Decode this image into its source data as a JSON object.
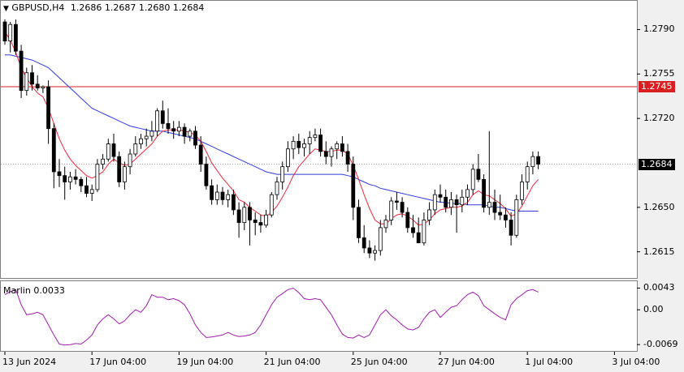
{
  "header": {
    "symbol_tf": "GBPUSD,H4",
    "ohlc": "1.2686 1.2687 1.2680 1.2684"
  },
  "indicator": {
    "title": "Marlin 0.0033"
  },
  "colors": {
    "bull": "#ffffff",
    "bear": "#000000",
    "outline": "#000000",
    "ma_fast": "#e8283c",
    "ma_slow": "#2f3cd8",
    "hline": "#d82020",
    "osc": "#9c1ea8",
    "grid": "#c8c8c8",
    "current": "#000000"
  },
  "chart_data": [
    {
      "type": "candlestick",
      "symbol": "GBPUSD",
      "timeframe": "H4",
      "y_ticks": [
        "1.2790",
        "1.2755",
        "1.2720",
        "1.2650",
        "1.2615"
      ],
      "ylim": [
        1.2595,
        1.2812
      ],
      "horizontal_line": {
        "value": "1.2745"
      },
      "current_price": "1.2684",
      "x_labels": [
        "13 Jun 2024",
        "17 Jun 04:00",
        "19 Jun 04:00",
        "21 Jun 04:00",
        "25 Jun 04:00",
        "27 Jun 04:00",
        "1 Jul 04:00",
        "3 Jul 04:00"
      ],
      "x_label_bar_index": [
        0,
        16,
        32,
        48,
        64,
        80,
        96,
        112
      ],
      "candles": [
        [
          1.2796,
          1.2798,
          1.2778,
          1.2781
        ],
        [
          1.2781,
          1.2796,
          1.2772,
          1.2794
        ],
        [
          1.2794,
          1.2798,
          1.277,
          1.2773
        ],
        [
          1.2773,
          1.2778,
          1.2736,
          1.2742
        ],
        [
          1.2742,
          1.276,
          1.2738,
          1.2756
        ],
        [
          1.2756,
          1.2762,
          1.2742,
          1.2747
        ],
        [
          1.2747,
          1.2754,
          1.2742,
          1.2744
        ],
        [
          1.2744,
          1.2746,
          1.274,
          1.2745
        ],
        [
          1.2745,
          1.275,
          1.27,
          1.2712
        ],
        [
          1.2712,
          1.2716,
          1.2665,
          1.2678
        ],
        [
          1.2678,
          1.2688,
          1.2666,
          1.2675
        ],
        [
          1.2675,
          1.2682,
          1.2656,
          1.267
        ],
        [
          1.267,
          1.2678,
          1.2664,
          1.2674
        ],
        [
          1.2674,
          1.268,
          1.2668,
          1.2672
        ],
        [
          1.2672,
          1.2674,
          1.2662,
          1.2667
        ],
        [
          1.2667,
          1.2674,
          1.2658,
          1.2661
        ],
        [
          1.2661,
          1.2668,
          1.2655,
          1.2664
        ],
        [
          1.2664,
          1.2688,
          1.2662,
          1.2684
        ],
        [
          1.2684,
          1.2692,
          1.268,
          1.2688
        ],
        [
          1.2688,
          1.2704,
          1.2686,
          1.27
        ],
        [
          1.27,
          1.2708,
          1.2686,
          1.269
        ],
        [
          1.269,
          1.2694,
          1.2666,
          1.267
        ],
        [
          1.267,
          1.2686,
          1.2664,
          1.2682
        ],
        [
          1.2682,
          1.2696,
          1.2676,
          1.2692
        ],
        [
          1.2692,
          1.2706,
          1.269,
          1.27
        ],
        [
          1.27,
          1.2708,
          1.2696,
          1.2704
        ],
        [
          1.2704,
          1.2712,
          1.2698,
          1.2706
        ],
        [
          1.2706,
          1.2718,
          1.2702,
          1.271
        ],
        [
          1.271,
          1.2728,
          1.2706,
          1.2726
        ],
        [
          1.2726,
          1.2734,
          1.2712,
          1.2716
        ],
        [
          1.2716,
          1.2728,
          1.2708,
          1.2712
        ],
        [
          1.2712,
          1.2718,
          1.2704,
          1.271
        ],
        [
          1.271,
          1.2718,
          1.2706,
          1.2713
        ],
        [
          1.2713,
          1.2716,
          1.27,
          1.2706
        ],
        [
          1.2706,
          1.2712,
          1.2702,
          1.271
        ],
        [
          1.271,
          1.2714,
          1.2696,
          1.2699
        ],
        [
          1.2699,
          1.2706,
          1.2678,
          1.2684
        ],
        [
          1.2684,
          1.269,
          1.2664,
          1.2667
        ],
        [
          1.2667,
          1.2672,
          1.2652,
          1.2656
        ],
        [
          1.2656,
          1.2668,
          1.2652,
          1.2662
        ],
        [
          1.2662,
          1.2666,
          1.2652,
          1.2656
        ],
        [
          1.2656,
          1.2664,
          1.265,
          1.266
        ],
        [
          1.266,
          1.2664,
          1.2644,
          1.2648
        ],
        [
          1.2648,
          1.2654,
          1.2626,
          1.2638
        ],
        [
          1.2638,
          1.2654,
          1.2632,
          1.265
        ],
        [
          1.265,
          1.2654,
          1.262,
          1.264
        ],
        [
          1.264,
          1.2646,
          1.2628,
          1.2638
        ],
        [
          1.2638,
          1.2644,
          1.263,
          1.2636
        ],
        [
          1.2636,
          1.2648,
          1.2634,
          1.2644
        ],
        [
          1.2644,
          1.2662,
          1.2642,
          1.266
        ],
        [
          1.266,
          1.2674,
          1.2656,
          1.267
        ],
        [
          1.267,
          1.2686,
          1.2664,
          1.2682
        ],
        [
          1.2682,
          1.2702,
          1.2678,
          1.2696
        ],
        [
          1.2696,
          1.2706,
          1.2688,
          1.2702
        ],
        [
          1.2702,
          1.2708,
          1.2692,
          1.2697
        ],
        [
          1.2697,
          1.2704,
          1.269,
          1.27
        ],
        [
          1.27,
          1.271,
          1.2692,
          1.2705
        ],
        [
          1.2705,
          1.2712,
          1.2702,
          1.2707
        ],
        [
          1.2707,
          1.2712,
          1.269,
          1.2694
        ],
        [
          1.2694,
          1.2702,
          1.2684,
          1.269
        ],
        [
          1.269,
          1.2698,
          1.2682,
          1.2696
        ],
        [
          1.2696,
          1.2702,
          1.2688,
          1.27
        ],
        [
          1.27,
          1.2706,
          1.269,
          1.2694
        ],
        [
          1.2694,
          1.27,
          1.2678,
          1.2684
        ],
        [
          1.2684,
          1.269,
          1.264,
          1.265
        ],
        [
          1.265,
          1.2656,
          1.2622,
          1.2626
        ],
        [
          1.2626,
          1.2636,
          1.2614,
          1.2618
        ],
        [
          1.2618,
          1.2624,
          1.261,
          1.2614
        ],
        [
          1.2614,
          1.262,
          1.2608,
          1.2616
        ],
        [
          1.2616,
          1.264,
          1.2612,
          1.2634
        ],
        [
          1.2634,
          1.2644,
          1.263,
          1.264
        ],
        [
          1.264,
          1.2658,
          1.2636,
          1.2655
        ],
        [
          1.2655,
          1.2662,
          1.2648,
          1.2654
        ],
        [
          1.2654,
          1.2658,
          1.2642,
          1.2646
        ],
        [
          1.2646,
          1.265,
          1.263,
          1.2634
        ],
        [
          1.2634,
          1.2644,
          1.2626,
          1.263
        ],
        [
          1.263,
          1.2642,
          1.2624,
          1.2622
        ],
        [
          1.2622,
          1.2646,
          1.262,
          1.264
        ],
        [
          1.264,
          1.2654,
          1.2636,
          1.2648
        ],
        [
          1.2648,
          1.2664,
          1.2644,
          1.266
        ],
        [
          1.266,
          1.2668,
          1.2654,
          1.2658
        ],
        [
          1.2658,
          1.2664,
          1.2646,
          1.265
        ],
        [
          1.265,
          1.2662,
          1.2644,
          1.2656
        ],
        [
          1.2656,
          1.266,
          1.263,
          1.2652
        ],
        [
          1.2652,
          1.2664,
          1.2646,
          1.2658
        ],
        [
          1.2658,
          1.2668,
          1.2652,
          1.2664
        ],
        [
          1.2664,
          1.2684,
          1.266,
          1.268
        ],
        [
          1.268,
          1.2692,
          1.267,
          1.2672
        ],
        [
          1.2672,
          1.2676,
          1.2646,
          1.265
        ],
        [
          1.265,
          1.271,
          1.2644,
          1.2654
        ],
        [
          1.2654,
          1.2664,
          1.264,
          1.2646
        ],
        [
          1.2646,
          1.266,
          1.264,
          1.2644
        ],
        [
          1.2644,
          1.265,
          1.2634,
          1.264
        ],
        [
          1.264,
          1.2646,
          1.262,
          1.2628
        ],
        [
          1.2628,
          1.266,
          1.2626,
          1.2656
        ],
        [
          1.2656,
          1.2676,
          1.2652,
          1.267
        ],
        [
          1.267,
          1.2686,
          1.2664,
          1.2682
        ],
        [
          1.2682,
          1.2694,
          1.2676,
          1.269
        ],
        [
          1.269,
          1.2694,
          1.268,
          1.2684
        ]
      ],
      "ma_fast": [
        1.2788,
        1.2782,
        1.2772,
        1.276,
        1.2752,
        1.2745,
        1.274,
        1.2737,
        1.2728,
        1.2716,
        1.2704,
        1.2695,
        1.2688,
        1.2683,
        1.2679,
        1.2675,
        1.2673,
        1.2675,
        1.2678,
        1.2684,
        1.2688,
        1.2685,
        1.2683,
        1.2684,
        1.2688,
        1.2692,
        1.2696,
        1.27,
        1.2706,
        1.271,
        1.2711,
        1.2711,
        1.2711,
        1.271,
        1.2709,
        1.2707,
        1.2702,
        1.2694,
        1.2685,
        1.2679,
        1.2673,
        1.2668,
        1.2663,
        1.2656,
        1.2654,
        1.265,
        1.2647,
        1.2644,
        1.2643,
        1.2646,
        1.2651,
        1.2658,
        1.2666,
        1.2675,
        1.2682,
        1.2687,
        1.2692,
        1.2696,
        1.2695,
        1.2694,
        1.2694,
        1.2695,
        1.2695,
        1.2692,
        1.2683,
        1.2672,
        1.266,
        1.2649,
        1.264,
        1.2637,
        1.2637,
        1.2641,
        1.2644,
        1.2645,
        1.2643,
        1.264,
        1.2636,
        1.2637,
        1.264,
        1.2645,
        1.2648,
        1.2649,
        1.265,
        1.265,
        1.2651,
        1.2654,
        1.266,
        1.2663,
        1.266,
        1.2659,
        1.2656,
        1.2653,
        1.2649,
        1.2643,
        1.2645,
        1.2651,
        1.2659,
        1.2667,
        1.2672
      ],
      "ma_slow": [
        1.277,
        1.277,
        1.2769,
        1.2768,
        1.2767,
        1.2766,
        1.2764,
        1.2762,
        1.276,
        1.2756,
        1.2752,
        1.2748,
        1.2744,
        1.274,
        1.2736,
        1.2732,
        1.2728,
        1.2726,
        1.2724,
        1.2722,
        1.272,
        1.2718,
        1.2716,
        1.2714,
        1.2713,
        1.2712,
        1.2711,
        1.271,
        1.271,
        1.271,
        1.2709,
        1.2708,
        1.2707,
        1.2706,
        1.2705,
        1.2704,
        1.2702,
        1.27,
        1.2698,
        1.2696,
        1.2694,
        1.2692,
        1.269,
        1.2688,
        1.2686,
        1.2684,
        1.2682,
        1.268,
        1.2678,
        1.2677,
        1.2676,
        1.2676,
        1.2676,
        1.2676,
        1.2676,
        1.2676,
        1.2676,
        1.2676,
        1.2676,
        1.2676,
        1.2676,
        1.2676,
        1.2676,
        1.2675,
        1.2674,
        1.2672,
        1.267,
        1.2668,
        1.2667,
        1.2665,
        1.2664,
        1.2663,
        1.2662,
        1.2661,
        1.266,
        1.2659,
        1.2658,
        1.2657,
        1.2656,
        1.2655,
        1.2654,
        1.2654,
        1.2653,
        1.2653,
        1.2653,
        1.2652,
        1.2652,
        1.2652,
        1.2652,
        1.2651,
        1.265,
        1.265,
        1.2649,
        1.2648,
        1.2647,
        1.2647,
        1.2647,
        1.2647,
        1.2647
      ]
    },
    {
      "type": "line",
      "name": "Marlin",
      "y_ticks": [
        "0.0043",
        "0.00",
        "-0.0069"
      ],
      "ylim": [
        -0.008,
        0.0055
      ],
      "values": [
        0.003,
        0.0036,
        0.004,
        0.001,
        -0.001,
        -0.0008,
        -0.0005,
        -0.001,
        -0.003,
        -0.005,
        -0.0068,
        -0.007,
        -0.0069,
        -0.0067,
        -0.0068,
        -0.006,
        -0.005,
        -0.003,
        -0.0018,
        -0.001,
        -0.0018,
        -0.0028,
        -0.0022,
        -0.001,
        0.0,
        -0.0005,
        0.0008,
        0.003,
        0.0025,
        0.0025,
        0.002,
        0.0022,
        0.0018,
        0.001,
        -0.0008,
        -0.003,
        -0.0045,
        -0.0055,
        -0.0054,
        -0.0052,
        -0.005,
        -0.0045,
        -0.005,
        -0.0053,
        -0.0052,
        -0.005,
        -0.0045,
        -0.003,
        -0.001,
        0.001,
        0.0025,
        0.0032,
        0.004,
        0.0043,
        0.0034,
        0.0022,
        0.002,
        0.0022,
        0.002,
        0.0005,
        -0.001,
        -0.003,
        -0.0048,
        -0.0055,
        -0.0056,
        -0.005,
        -0.0055,
        -0.005,
        -0.003,
        -0.001,
        0.0,
        -0.0012,
        -0.002,
        -0.003,
        -0.0038,
        -0.004,
        -0.0035,
        -0.0018,
        -0.0005,
        0.0,
        -0.0015,
        -0.0005,
        0.0005,
        0.0008,
        0.002,
        0.003,
        0.0035,
        0.0028,
        0.0008,
        0.0,
        -0.0008,
        -0.0015,
        -0.002,
        0.001,
        0.0022,
        0.003,
        0.0038,
        0.004,
        0.0035
      ]
    }
  ]
}
